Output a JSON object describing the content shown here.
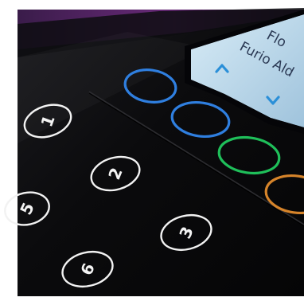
{
  "display": {
    "line_1": "Flo",
    "line_2": "Furio Ald"
  },
  "keypad": {
    "keys": [
      {
        "label": "1"
      },
      {
        "label": "2"
      },
      {
        "label": "3"
      },
      {
        "label": "5"
      },
      {
        "label": "6"
      }
    ]
  },
  "function_buttons": [
    {
      "color": "#2f7fe0"
    },
    {
      "color": "#2f7fe0"
    },
    {
      "color": "#1fbf5a"
    },
    {
      "color": "#d6842a"
    }
  ],
  "colors": {
    "device_body": "#0c0c0e",
    "accent_purple": "#6a2a7a",
    "lcd_background": "#b9d6ea",
    "lcd_arrow": "#2a8fd8"
  }
}
